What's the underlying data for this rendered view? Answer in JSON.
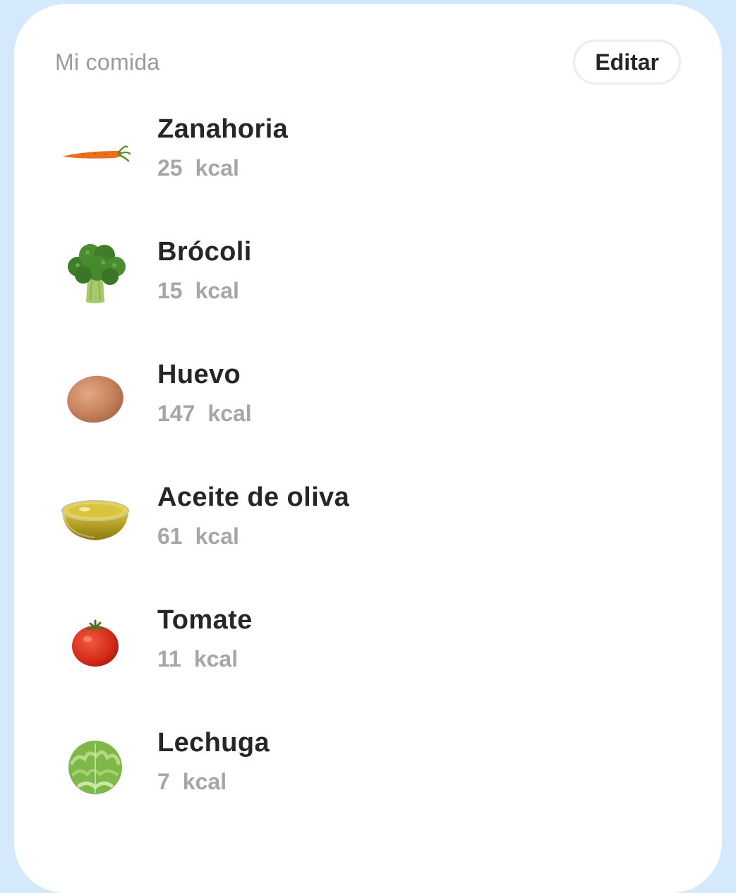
{
  "card": {
    "title": "Mi comida",
    "edit_label": "Editar"
  },
  "foods": [
    {
      "name": "Zanahoria",
      "kcal": "25",
      "icon": "carrot-icon"
    },
    {
      "name": "Brócoli",
      "kcal": "15",
      "icon": "broccoli-icon"
    },
    {
      "name": "Huevo",
      "kcal": "147",
      "icon": "egg-icon"
    },
    {
      "name": "Aceite de oliva",
      "kcal": "61",
      "icon": "olive-oil-bowl-icon"
    },
    {
      "name": "Tomate",
      "kcal": "11",
      "icon": "tomato-icon"
    },
    {
      "name": "Lechuga",
      "kcal": "7",
      "icon": "lettuce-icon"
    }
  ],
  "kcal_unit": "kcal",
  "colors": {
    "page_background": "#d4e9fb",
    "card_background": "#ffffff",
    "title_text": "#262626",
    "muted_text": "#9a9a9a"
  }
}
